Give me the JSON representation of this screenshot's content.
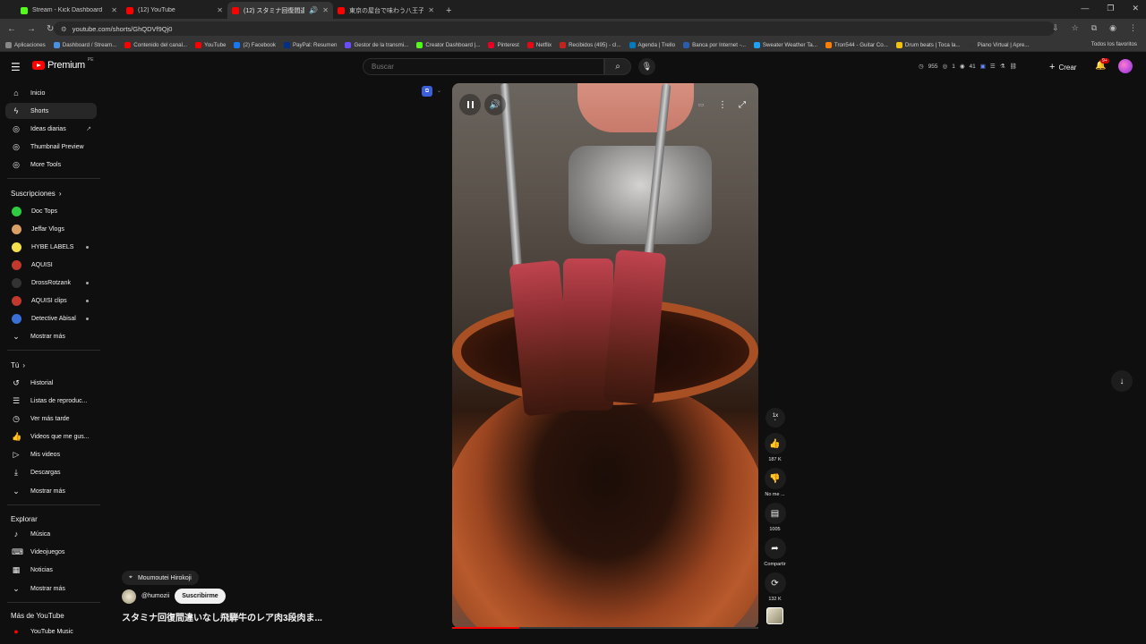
{
  "browser": {
    "tabs": [
      {
        "title": "Stream - Kick Dashboard",
        "favicon_color": "#53fc18"
      },
      {
        "title": "(12) YouTube",
        "favicon_color": "#ff0000"
      },
      {
        "title": "(12) スタミナ回復間違いなし飛",
        "favicon_color": "#ff0000",
        "active": true
      },
      {
        "title": "東京の屋台で味わう八王子ラーメン",
        "favicon_color": "#ff0000"
      }
    ],
    "url": "youtube.com/shorts/GhQDVf9Qj0",
    "bookmarks": [
      "Aplicaciones",
      "Dashboard / Stream...",
      "Contenido del canal...",
      "YouTube",
      "(2) Facebook",
      "PayPal: Resumen",
      "Gestor de la transmi...",
      "Creator Dashboard |...",
      "Pinterest",
      "Netflix",
      "Recibidos (495) - cl...",
      "Agenda | Trello",
      "Banca por Internet -...",
      "Sweater Weather Ta...",
      "Tron544 - Guitar Co...",
      "Drum beats | Toca la...",
      "Piano Virtual | Apre..."
    ],
    "bookmarks_right": "Todos los favoritos"
  },
  "masthead": {
    "logo_text": "Premium",
    "logo_sup": "PE",
    "search_placeholder": "Buscar",
    "stats": [
      "955",
      "1",
      "41"
    ],
    "create_label": "Crear",
    "notif_count": "9+"
  },
  "sidebar": {
    "main": [
      {
        "label": "Inicio",
        "icon": "home-icon"
      },
      {
        "label": "Shorts",
        "icon": "shorts-icon",
        "active": true
      },
      {
        "label": "Ideas diarias",
        "icon": "ideas-icon"
      },
      {
        "label": "Thumbnail Preview",
        "icon": "thumbnail-icon"
      },
      {
        "label": "More Tools",
        "icon": "tools-icon"
      }
    ],
    "subs_header": "Suscripciones",
    "subs": [
      {
        "label": "Doc Tops",
        "color": "#2ecc40"
      },
      {
        "label": "Jeffar Vlogs",
        "color": "#d9a066"
      },
      {
        "label": "HYBE LABELS",
        "color": "#f4e04d"
      },
      {
        "label": "AQUISI",
        "color": "#c0392b"
      },
      {
        "label": "DrossRotzank",
        "color": "#333333"
      },
      {
        "label": "AQUISI clips",
        "color": "#c0392b"
      },
      {
        "label": "Detective Abisal",
        "color": "#3a6fd8"
      }
    ],
    "subs_more": "Mostrar más",
    "you_header": "Tú",
    "you": [
      {
        "label": "Historial",
        "icon": "history-icon"
      },
      {
        "label": "Listas de reproduc...",
        "icon": "playlist-icon"
      },
      {
        "label": "Ver más tarde",
        "icon": "clock-icon"
      },
      {
        "label": "Videos que me gus...",
        "icon": "like-icon"
      },
      {
        "label": "Mis videos",
        "icon": "video-icon"
      },
      {
        "label": "Descargas",
        "icon": "download-icon"
      }
    ],
    "you_more": "Mostrar más",
    "explore_header": "Explorar",
    "explore": [
      {
        "label": "Música",
        "icon": "music-icon"
      },
      {
        "label": "Videojuegos",
        "icon": "gamepad-icon"
      },
      {
        "label": "Noticias",
        "icon": "news-icon"
      }
    ],
    "explore_more": "Mostrar más",
    "more_header": "Más de YouTube",
    "more": [
      {
        "label": "YouTube Music",
        "icon": "youtube-music-icon"
      }
    ]
  },
  "short": {
    "progress_fraction": 0.22,
    "speed_label": "1x",
    "actions": {
      "like_count": "187 K",
      "dislike_label": "No me ...",
      "comments_count": "1005",
      "share_label": "Compartir",
      "remix_count": "132 K"
    },
    "location": "Moumoutei Hirokoji",
    "channel": "@humozii",
    "subscribe_label": "Suscribirme",
    "title": "スタミナ回復間違いなし飛騨牛のレア肉3段肉ま..."
  },
  "colors": {
    "accent": "#ff0000",
    "background": "#0f0f0f"
  }
}
